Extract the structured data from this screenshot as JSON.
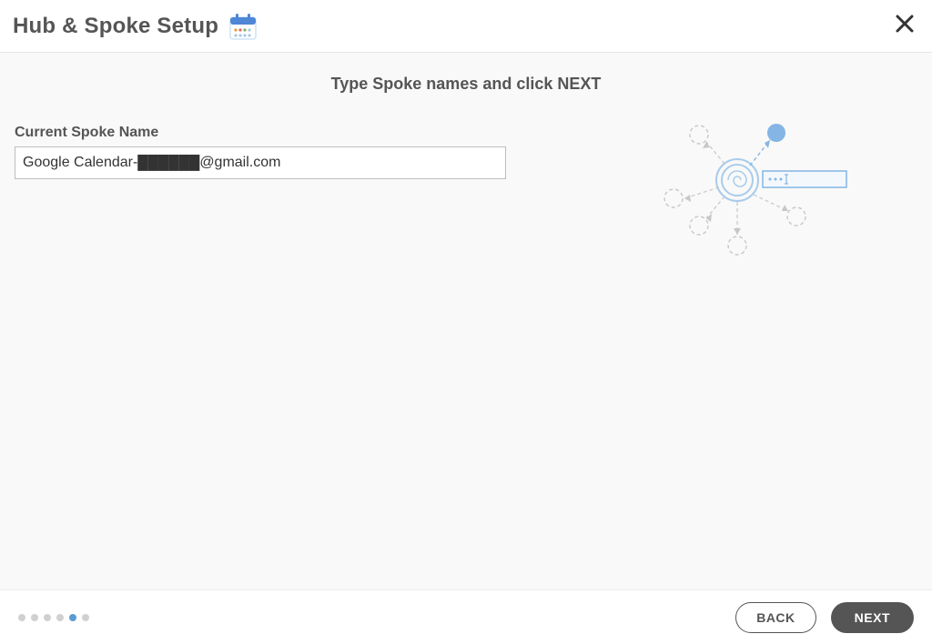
{
  "header": {
    "title": "Hub & Spoke Setup"
  },
  "content": {
    "instruction": "Type Spoke names and click NEXT",
    "field_label": "Current Spoke Name",
    "field_value": "Google Calendar-██████@gmail.com"
  },
  "footer": {
    "back_label": "BACK",
    "next_label": "NEXT",
    "active_step_index": 4,
    "step_count": 6
  },
  "colors": {
    "accent": "#5b9bd5",
    "text": "#555555",
    "border": "#bdbdbd"
  }
}
